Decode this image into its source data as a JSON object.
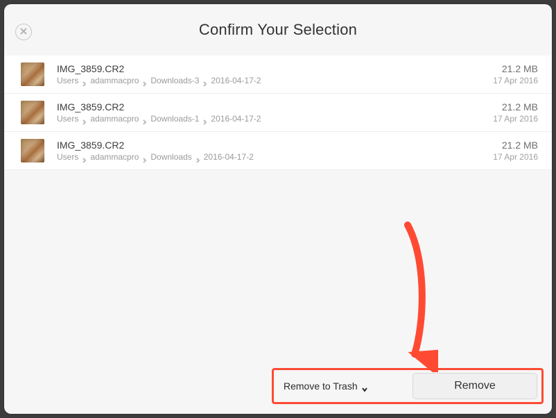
{
  "header": {
    "title": "Confirm Your Selection"
  },
  "files": [
    {
      "filename": "IMG_3859.CR2",
      "path": [
        "Users",
        "adammacpro",
        "Downloads-3",
        "2016-04-17-2"
      ],
      "size": "21.2 MB",
      "date": "17 Apr 2016"
    },
    {
      "filename": "IMG_3859.CR2",
      "path": [
        "Users",
        "adammacpro",
        "Downloads-1",
        "2016-04-17-2"
      ],
      "size": "21.2 MB",
      "date": "17 Apr 2016"
    },
    {
      "filename": "IMG_3859.CR2",
      "path": [
        "Users",
        "adammacpro",
        "Downloads",
        "2016-04-17-2"
      ],
      "size": "21.2 MB",
      "date": "17 Apr 2016"
    }
  ],
  "footer": {
    "option_label": "Remove to Trash",
    "button_label": "Remove"
  },
  "annotation": {
    "arrow_color": "#ff4a33"
  }
}
